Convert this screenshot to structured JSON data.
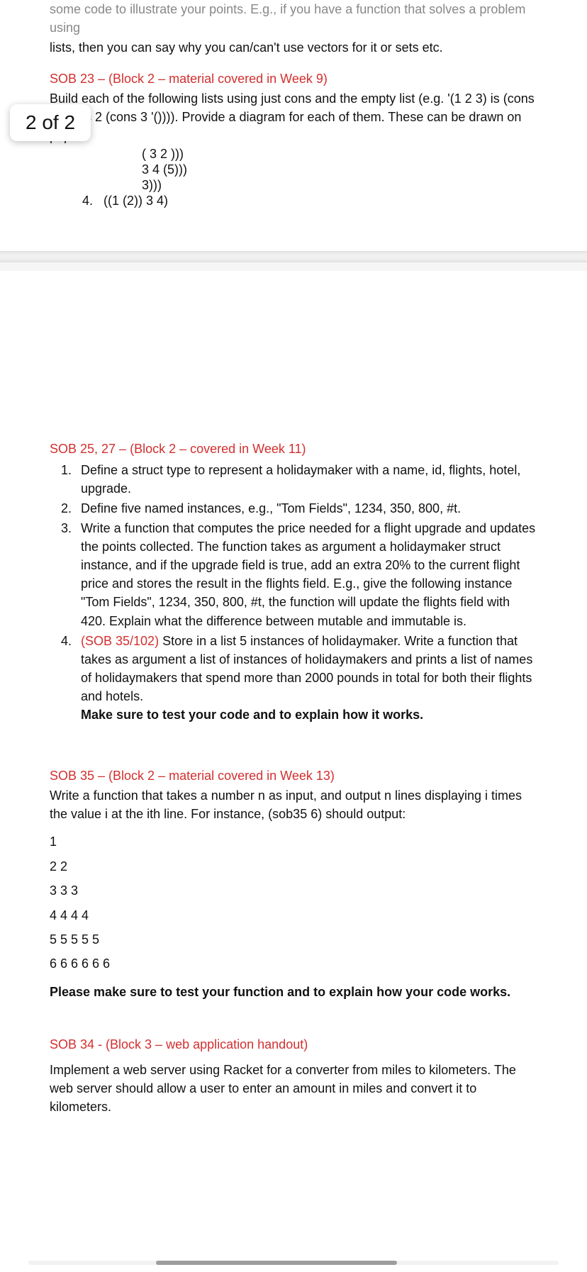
{
  "page_badge": "2 of 2",
  "top": {
    "truncated_line": "some code to illustrate your points. E.g., if you have a function that solves a problem using",
    "truncated_line2": "lists, then you can say why you can/can't use vectors for it or sets etc."
  },
  "sob23": {
    "heading": "SOB 23 – (Block 2 – material covered in Week 9)",
    "body": "Build each of the following lists using just cons and the empty list (e.g. '(1 2 3) is (cons 1 (cons 2 (cons 3 '()))). Provide a diagram for each of them. These can be drawn on paper.",
    "frag1": "( 3 2 )))",
    "frag2": "3 4 (5)))",
    "frag3": "3)))",
    "item4_num": "4.",
    "item4": "((1 (2)) 3 4)"
  },
  "sob25": {
    "heading": "SOB 25, 27 – (Block 2 – covered in Week 11)",
    "items": [
      {
        "num": "1.",
        "text": "Define a struct type to represent a holidaymaker with a name, id, flights, hotel, upgrade."
      },
      {
        "num": "2.",
        "text": "Define five named instances, e.g., \"Tom Fields\", 1234, 350, 800, #t."
      },
      {
        "num": "3.",
        "text": "Write a function that computes the price needed for a flight upgrade and updates the points collected. The function takes as argument a holidaymaker struct instance, and if the upgrade field is true, add an extra 20% to the current flight price and stores the result in the flights field. E.g., give the following instance \"Tom Fields\", 1234, 350, 800, #t, the function will update the flights field with 420. Explain what the difference between mutable and immutable is."
      },
      {
        "num": "4.",
        "prefix": "(SOB 35/102) ",
        "text": "Store in a list 5 instances of holidaymaker. Write a function that takes as argument a list of instances of holidaymakers and prints a list of names of holidaymakers that spend more than 2000 pounds in total for both their flights and hotels.",
        "bold_tail": "Make sure to test your code and to explain how it works."
      }
    ]
  },
  "sob35": {
    "heading": "SOB 35 – (Block 2 – material covered in Week 13)",
    "body": "Write a function that takes a number n as input, and output n lines displaying i times the value i at the ith line. For instance, (sob35 6) should output:",
    "lines": [
      "1",
      "2 2",
      "3 3 3",
      "4 4 4 4",
      "5 5 5 5 5",
      "6 6 6 6 6 6"
    ],
    "footer": "Please make sure to test your function and to explain how your code works."
  },
  "sob34": {
    "heading": "SOB 34 - (Block 3 – web application handout)",
    "body": "Implement a web server using Racket for a converter from miles to kilometers. The web server should allow a user to enter an amount in miles and convert it to kilometers."
  }
}
